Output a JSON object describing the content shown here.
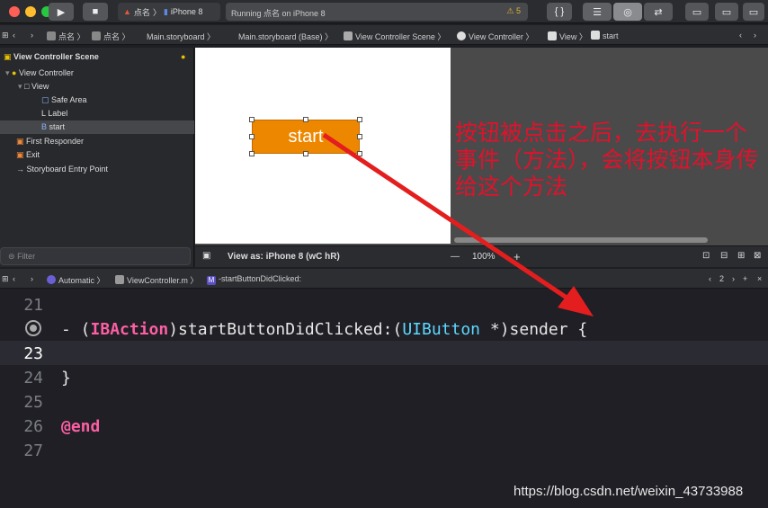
{
  "toolbar": {
    "scheme_app": "点名",
    "scheme_device": "iPhone 8",
    "status": "Running 点名 on iPhone 8",
    "warnings": "5",
    "braces": "{ }"
  },
  "jumpbar": {
    "crumbs": [
      "点名",
      "点名",
      "Main.storyboard",
      "Main.storyboard (Base)",
      "View Controller Scene",
      "View Controller",
      "View",
      "start"
    ]
  },
  "outline": {
    "header": "View Controller Scene",
    "items": [
      {
        "label": "View Controller"
      },
      {
        "label": "View"
      },
      {
        "label": "Safe Area"
      },
      {
        "label": "Label"
      },
      {
        "label": "start"
      },
      {
        "label": "First Responder"
      },
      {
        "label": "Exit"
      },
      {
        "label": "Storyboard Entry Point"
      }
    ],
    "filter_placeholder": "Filter"
  },
  "canvas": {
    "button_title": "start",
    "annotation": "按钮被点击之后，去执行一个事件（方法），会将按钮本身传给这个方法",
    "view_as": "View as: iPhone 8 (wC hR)",
    "zoom": "100%",
    "minus": "—",
    "plus": "+"
  },
  "editor_jump": {
    "mode": "Automatic",
    "file": "ViewController.m",
    "method_badge": "M",
    "method": "-startButtonDidClicked:",
    "counterpart": "2"
  },
  "code": {
    "line21": "21",
    "line22_dash": "- (",
    "line22_ibaction": "IBAction",
    "line22_mid": ")startButtonDidClicked:(",
    "line22_type": "UIButton",
    "line22_end": " *)sender {",
    "line23": "23",
    "line24": "24",
    "line24_code": "}",
    "line25": "25",
    "line26": "26",
    "line26_code": "@end",
    "line27": "27"
  },
  "watermark": "https://blog.csdn.net/weixin_43733988",
  "colors": {
    "arrow": "#e41e1e",
    "button": "#ee8700",
    "keyword": "#fc5fa3",
    "type": "#5dd8ff"
  }
}
